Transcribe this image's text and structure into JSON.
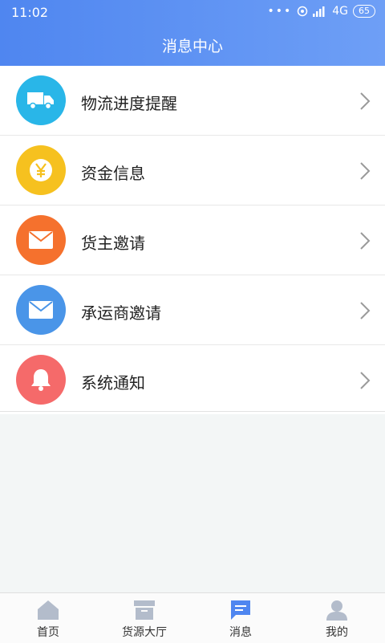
{
  "status": {
    "time": "11:02",
    "dots": "•••",
    "network": "4G",
    "battery": "65"
  },
  "header": {
    "title": "消息中心"
  },
  "colors": {
    "accent": "#4f86f0",
    "tab_inactive": "#b3bccb"
  },
  "items": [
    {
      "label": "物流进度提醒",
      "icon": "truck-icon",
      "color": "#29b6e8"
    },
    {
      "label": "资金信息",
      "icon": "yen-coin-icon",
      "color": "#f6c11f"
    },
    {
      "label": "货主邀请",
      "icon": "envelope-icon",
      "color": "#f5712d"
    },
    {
      "label": "承运商邀请",
      "icon": "envelope-icon",
      "color": "#4a95e8"
    },
    {
      "label": "系统通知",
      "icon": "bell-icon",
      "color": "#f56a6a"
    }
  ],
  "tabs": [
    {
      "label": "首页",
      "icon": "home-icon"
    },
    {
      "label": "货源大厅",
      "icon": "box-icon"
    },
    {
      "label": "消息",
      "icon": "message-icon",
      "active": true
    },
    {
      "label": "我的",
      "icon": "user-icon"
    }
  ]
}
